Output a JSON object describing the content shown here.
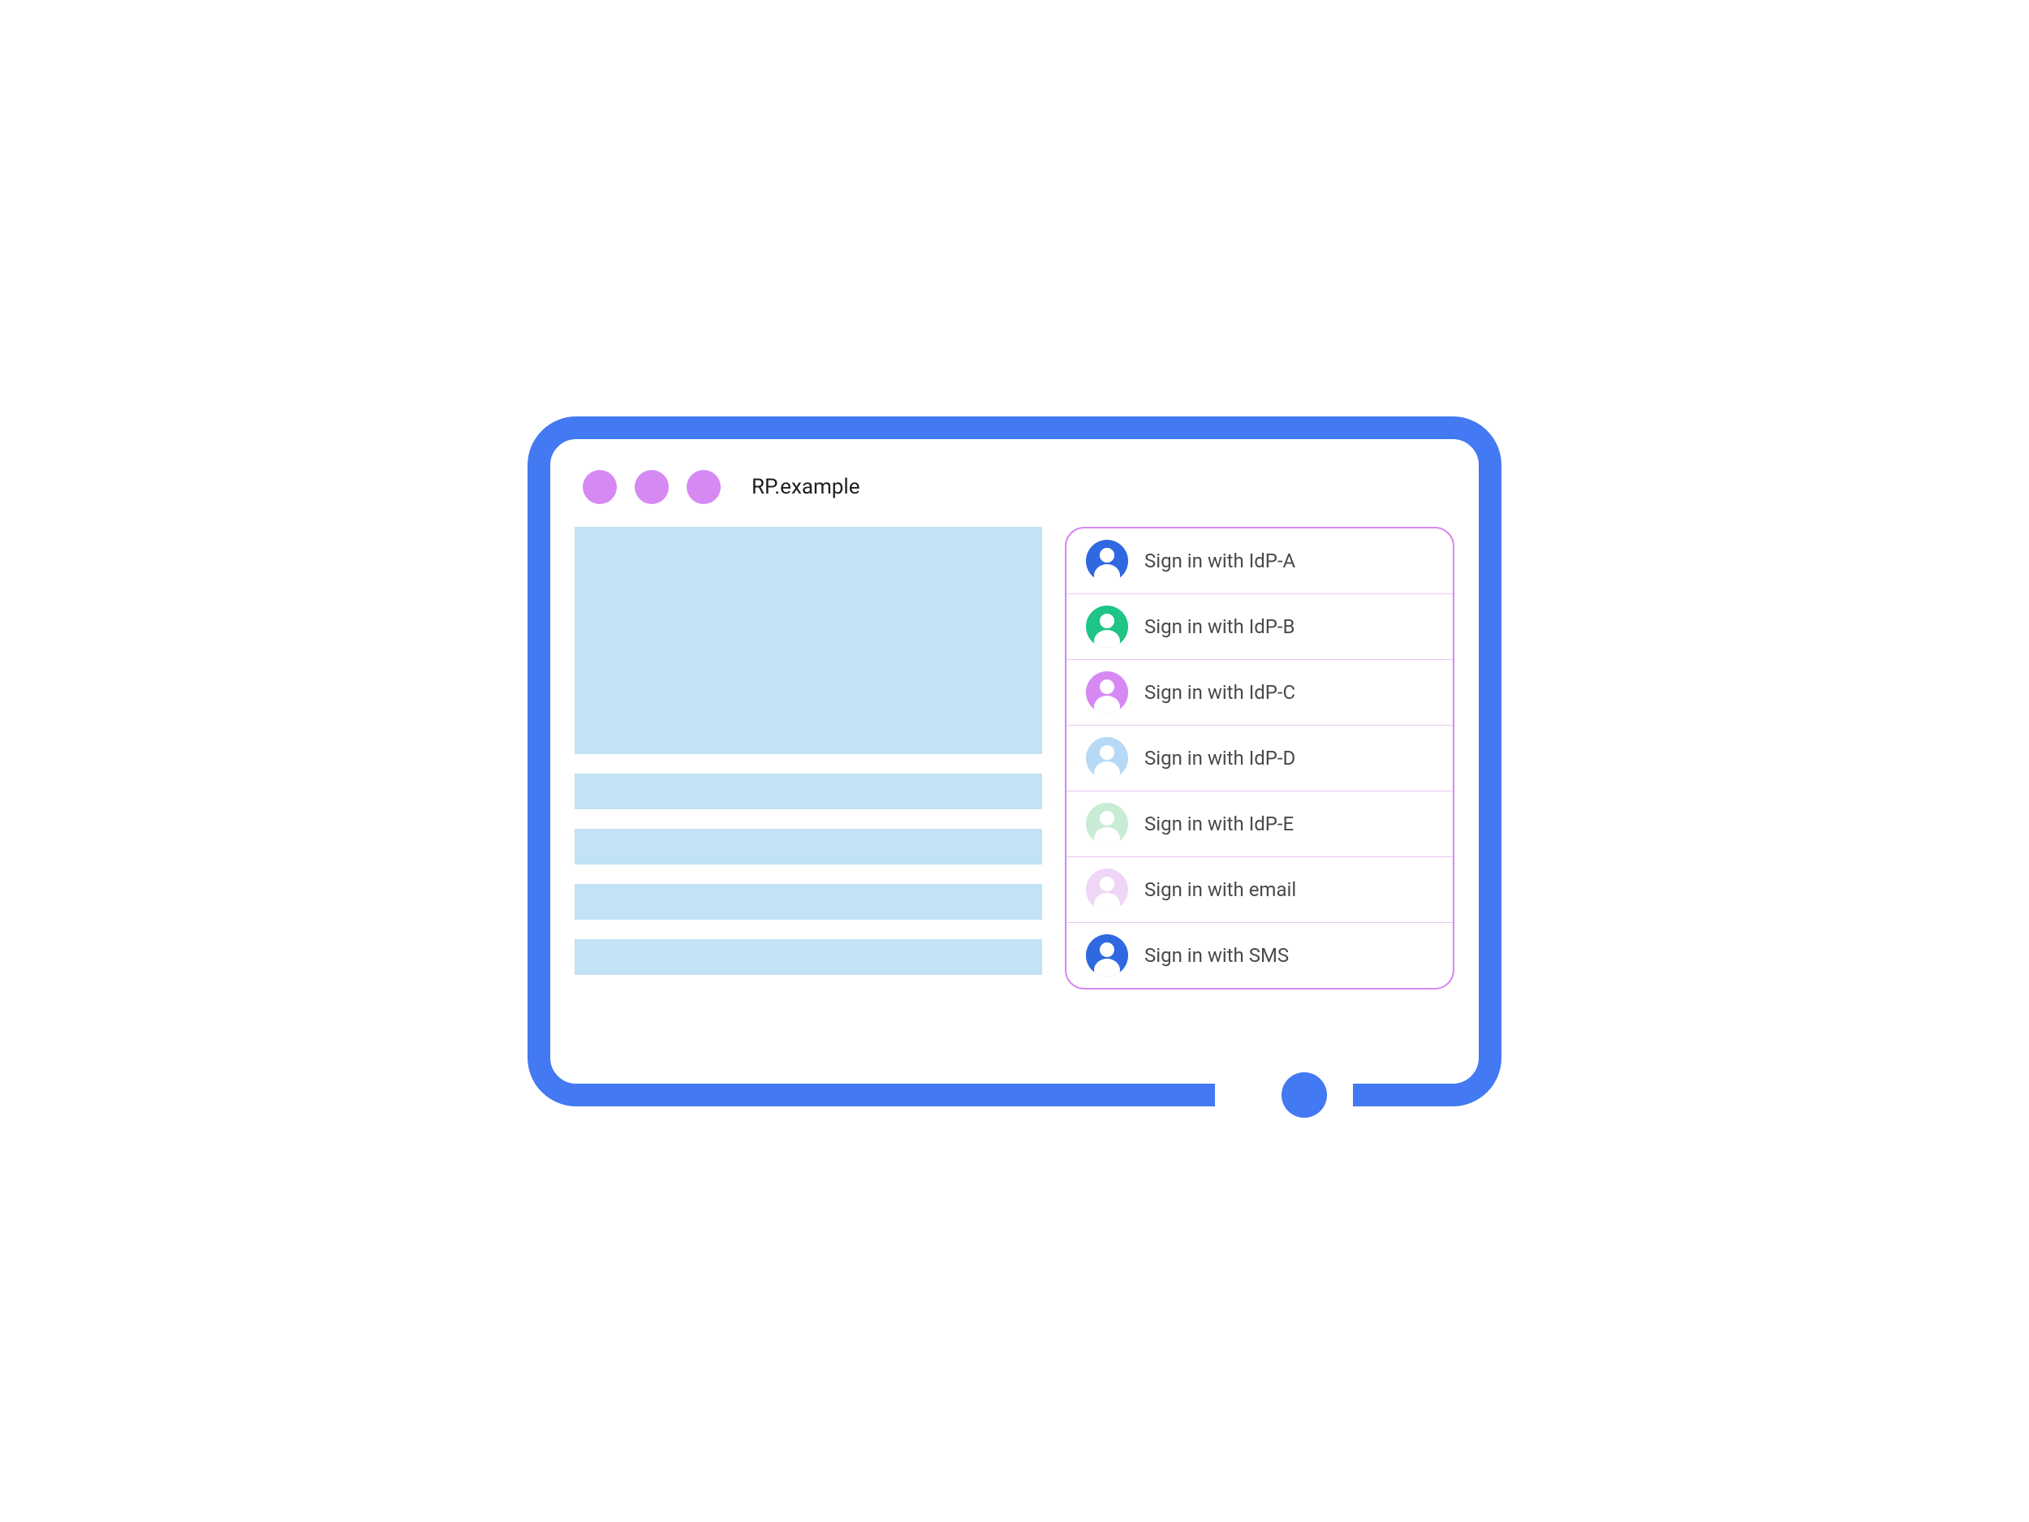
{
  "browser": {
    "address": "RP.example"
  },
  "signin": {
    "options": [
      {
        "label": "Sign in with IdP-A",
        "icon_color": "#2f68e0"
      },
      {
        "label": "Sign in with IdP-B",
        "icon_color": "#1fc487"
      },
      {
        "label": "Sign in with IdP-C",
        "icon_color": "#d688f3"
      },
      {
        "label": "Sign in with IdP-D",
        "icon_color": "#b8d9f5"
      },
      {
        "label": "Sign in with IdP-E",
        "icon_color": "#c8ecd4"
      },
      {
        "label": "Sign in with email",
        "icon_color": "#efd6f7"
      },
      {
        "label": "Sign in with SMS",
        "icon_color": "#2f68e0"
      }
    ]
  },
  "colors": {
    "frame": "#4379f2",
    "traffic_light": "#d688f3",
    "placeholder": "#c2e2f5",
    "panel_border": "#d688f3"
  }
}
